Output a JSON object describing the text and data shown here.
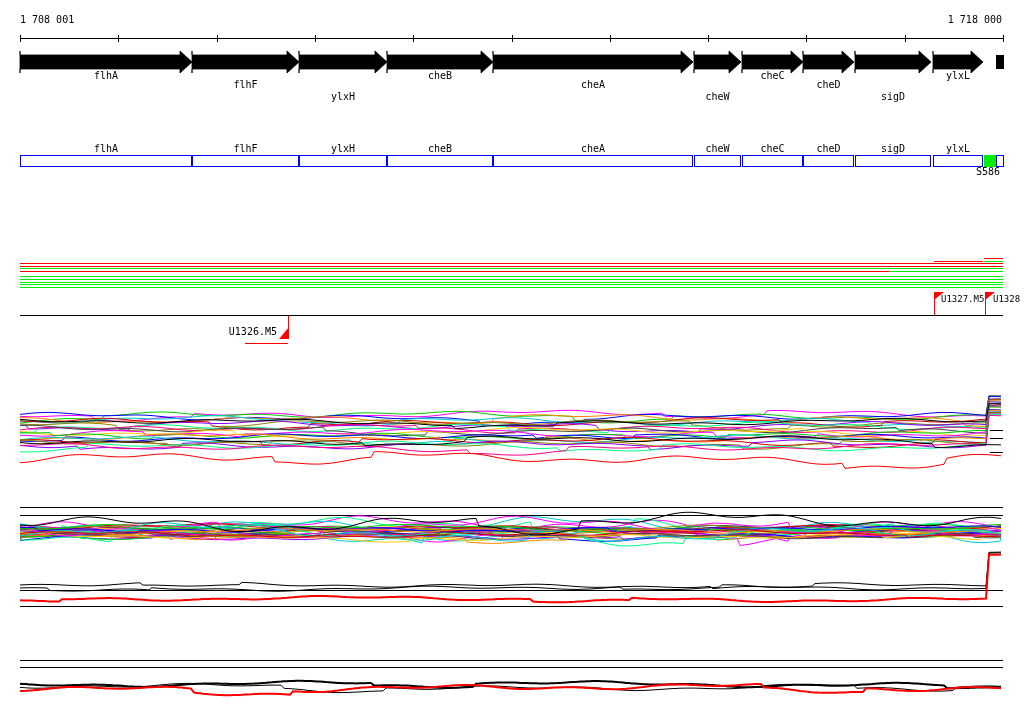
{
  "ruler": {
    "start": "1 708 001",
    "end": "1 718 000"
  },
  "genes": [
    {
      "name": "flhA"
    },
    {
      "name": "flhF"
    },
    {
      "name": "ylxH"
    },
    {
      "name": "cheB"
    },
    {
      "name": "cheA"
    },
    {
      "name": "cheW"
    },
    {
      "name": "cheC"
    },
    {
      "name": "cheD"
    },
    {
      "name": "sigD"
    },
    {
      "name": "ylxL"
    }
  ],
  "annotations": [
    {
      "name": "flhA"
    },
    {
      "name": "flhF"
    },
    {
      "name": "ylxH"
    },
    {
      "name": "cheB"
    },
    {
      "name": "cheA"
    },
    {
      "name": "cheW"
    },
    {
      "name": "cheC"
    },
    {
      "name": "cheD"
    },
    {
      "name": "sigD"
    },
    {
      "name": "ylxL"
    }
  ],
  "feature": {
    "label": "S586"
  },
  "markers": [
    {
      "label": "U1326.M5"
    },
    {
      "label": "U1327.M5"
    },
    {
      "label": "U1328"
    }
  ]
}
